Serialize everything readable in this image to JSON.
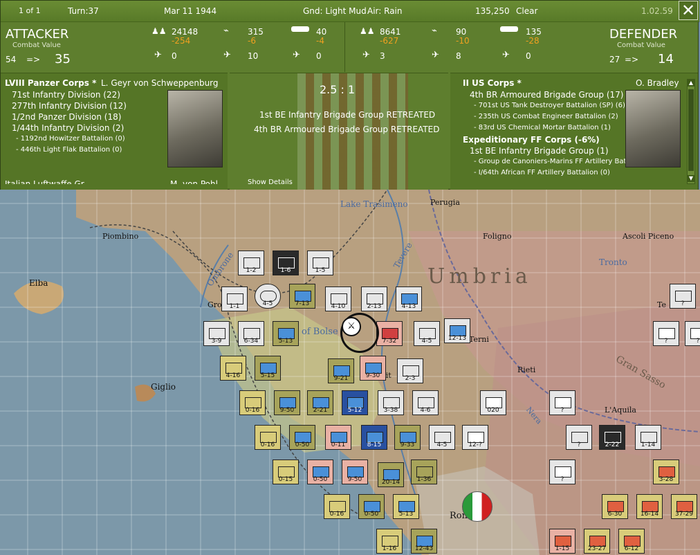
{
  "header": {
    "page": "1 of 1",
    "turn": "Turn:37",
    "date": "Mar 11 1944",
    "ground": "Gnd: Light Mud",
    "air": "Air: Rain",
    "points": "135,250",
    "weather": "Clear",
    "version": "1.02.59",
    "close_glyph": "✕"
  },
  "attacker": {
    "title": "ATTACKER",
    "cv_label": "Combat Value",
    "cv_from": "54",
    "arrow": "=>",
    "cv_to": "35",
    "stats": {
      "men": "24148",
      "men_loss": "-254",
      "planes": "315",
      "planes_loss": "-6",
      "tanks": "40",
      "tanks_loss": "-4",
      "fighters": "0",
      "bombers": "10",
      "transports": "0"
    }
  },
  "defender": {
    "title": "DEFENDER",
    "cv_label": "Combat Value",
    "cv_from": "27",
    "arrow": "=>",
    "cv_to": "14",
    "stats": {
      "men": "8641",
      "men_loss": "-627",
      "planes": "90",
      "planes_loss": "-10",
      "tanks": "135",
      "tanks_loss": "-28",
      "fighters": "3",
      "bombers": "8",
      "transports": "0"
    }
  },
  "attacker_oob": {
    "corps": "LVIII Panzer Corps *",
    "commander": "L. Geyr von Schweppenburg",
    "units": [
      "71st Infantry Division (22)",
      "277th Infantry Division (12)",
      "1/2nd Panzer Division (18)",
      "1/44th Infantry Division (2)"
    ],
    "subunits": [
      "- 1192nd Howitzer Battalion (0)",
      "- 446th Light Flak Battalion (0)"
    ],
    "cut_line": "Italian Luftwaffe Gr...",
    "cut_commander": "M. von Pohl"
  },
  "result": {
    "odds": "2.5 : 1",
    "lines": [
      "1st BE Infantry Brigade Group RETREATED",
      "4th BR Armoured Brigade Group RETREATED"
    ],
    "show_details": "Show Details"
  },
  "defender_oob": {
    "corps": "II US Corps *",
    "commander": "O. Bradley",
    "unit1": "4th BR Armoured Brigade Group (17)",
    "sub1": [
      "- 701st US Tank Destroyer Battalion (SP) (6)",
      "- 235th US Combat Engineer Battalion (2)",
      "- 83rd US Chemical Mortar Battalion (1)"
    ],
    "corps2": "Expeditionary FF Corps (-6%)",
    "unit2": "1st BE Infantry Brigade Group (1)",
    "sub2": [
      "- Group de Canoniers-Marins FF Artillery Battalion (0)",
      "- I/64th African FF Artillery Battalion (0)"
    ]
  },
  "map": {
    "places": {
      "piombino": "Piombino",
      "elba": "Elba",
      "giglio": "Giglio",
      "lake": "Lake Trasimeno",
      "perugia": "Perugia",
      "foligno": "Foligno",
      "ascoli": "Ascoli Piceno",
      "umbria": "Umbria",
      "tronto": "Tronto",
      "tevere": "Tevere",
      "ombrone": "Ombrone",
      "rieti": "Rieti",
      "aquila": "L'Aquila",
      "gransasso": "Gran Sasso",
      "nera": "Nera",
      "terni": "Terni",
      "rome": "Rome",
      "bolsena": "of Bolse",
      "gro": "Gro",
      "te": "Te",
      "vit": "Vit"
    },
    "counters": [
      "1-2",
      "1-6",
      "1-5",
      "1-1",
      "4-5",
      "7-13",
      "4-10",
      "2-13",
      "4-13",
      "3-9",
      "6-34",
      "5-13",
      "7-32",
      "4-5",
      "12-13",
      "4-16",
      "5-15",
      "9-21",
      "9-30",
      "2-3",
      "0-16",
      "9-50",
      "2-21",
      "5-12",
      "3-38",
      "4-6",
      "020",
      "?",
      "0-16",
      "0-50",
      "0-11",
      "8-15",
      "9-33",
      "4-5",
      "12-?",
      "?",
      "2-22",
      "1-14",
      "0-15",
      "0-50",
      "9-50",
      "20-14",
      "1-36",
      "?",
      "3-28",
      "0-16",
      "0-50",
      "5-13",
      "6-30",
      "16-14",
      "37-29",
      "1-16",
      "12-43",
      "1-15",
      "23-27",
      "6-12",
      "?",
      "?",
      "?"
    ]
  }
}
